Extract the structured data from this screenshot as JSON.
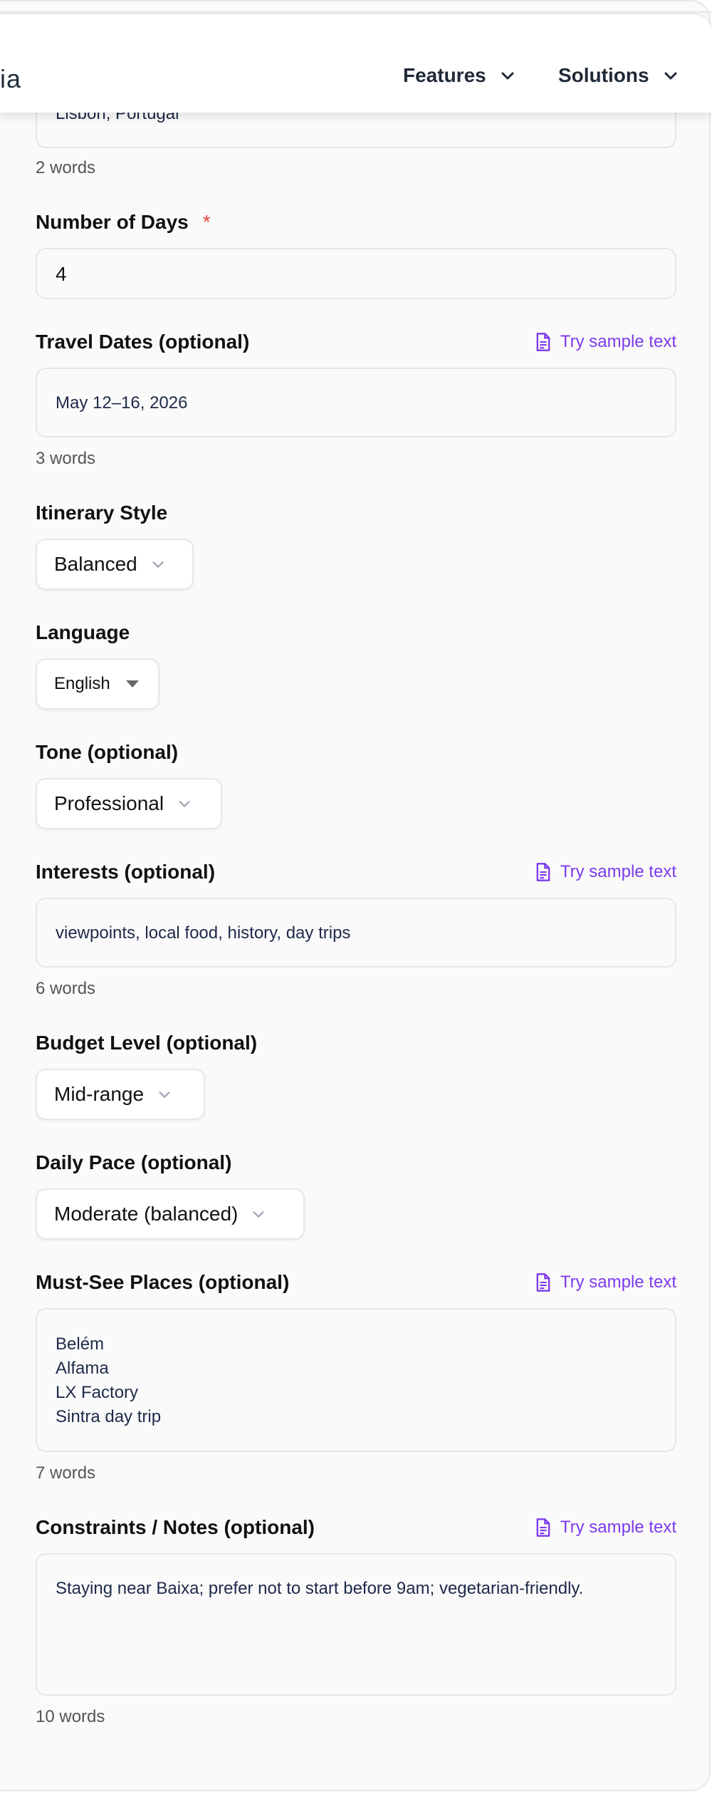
{
  "nav": {
    "logo_fragment": "ia",
    "features_label": "Features",
    "solutions_label": "Solutions"
  },
  "form": {
    "destination": {
      "value": "Lisbon, Portugal",
      "word_count": "2 words"
    },
    "days": {
      "label": "Number of Days",
      "required_mark": "*",
      "value": "4"
    },
    "dates": {
      "label": "Travel Dates (optional)",
      "sample_label": "Try sample text",
      "value": "May 12–16, 2026",
      "word_count": "3 words"
    },
    "style": {
      "label": "Itinerary Style",
      "selected": "Balanced"
    },
    "language": {
      "label": "Language",
      "selected": "English"
    },
    "tone": {
      "label": "Tone (optional)",
      "selected": "Professional"
    },
    "interests": {
      "label": "Interests (optional)",
      "sample_label": "Try sample text",
      "value": "viewpoints, local food, history, day trips",
      "word_count": "6 words"
    },
    "budget": {
      "label": "Budget Level (optional)",
      "selected": "Mid-range"
    },
    "pace": {
      "label": "Daily Pace (optional)",
      "selected": "Moderate (balanced)"
    },
    "must_see": {
      "label": "Must-See Places (optional)",
      "sample_label": "Try sample text",
      "lines": [
        "Belém",
        "Alfama",
        "LX Factory",
        "Sintra day trip"
      ],
      "word_count": "7 words"
    },
    "notes": {
      "label": "Constraints / Notes (optional)",
      "sample_label": "Try sample text",
      "value": "Staying near Baixa; prefer not to start before 9am; vegetarian-friendly.",
      "word_count": "10 words"
    }
  },
  "colors": {
    "accent": "#7c3aed",
    "required": "#ef4444",
    "border": "#e5e7eb",
    "text": "#111111",
    "muted": "#555555"
  },
  "icons": [
    "chevron-down-icon",
    "document-icon",
    "caret-down-icon"
  ]
}
